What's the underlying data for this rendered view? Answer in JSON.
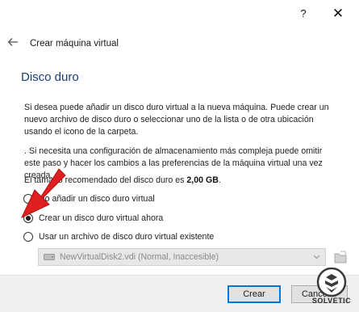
{
  "titlebar": {
    "help_label": "?",
    "close_label": "✕"
  },
  "wizard": {
    "title": "Crear máquina virtual",
    "back_icon": "back-arrow-icon"
  },
  "section": {
    "title": "Disco duro",
    "paragraph1": "Si desea puede añadir un disco duro virtual a la nueva máquina. Puede crear un nuevo archivo de disco duro o seleccionar uno de la lista o de otra ubicación usando el icono de la carpeta.",
    "paragraph2": ". Si necesita una configuración de almacenamiento más compleja puede omitir este paso y hacer los cambios a las preferencias de la máquina virtual una vez creada.",
    "recommend_prefix": "El tamaño recomendado del disco duro es ",
    "recommend_size": "2,00 GB",
    "recommend_suffix": "."
  },
  "options": [
    {
      "label": "No añadir un disco duro virtual",
      "checked": false
    },
    {
      "label": "Crear un disco duro virtual ahora",
      "checked": true
    },
    {
      "label": "Usar un archivo de disco duro virtual existente",
      "checked": false
    }
  ],
  "disk_selector": {
    "value": "NewVirtualDisk2.vdi (Normal, Inaccesible)",
    "icon": "hard-disk-icon",
    "browse_icon": "folder-browse-icon"
  },
  "buttons": {
    "create": "Crear",
    "cancel": "Cancelar"
  },
  "watermark": {
    "text": "SOLVETIC"
  },
  "colors": {
    "section_title": "#163f78",
    "default_button_border": "#0078d7",
    "annotation_arrow": "#e02020"
  }
}
